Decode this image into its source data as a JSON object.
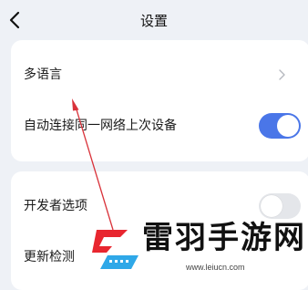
{
  "header": {
    "title": "设置",
    "back_icon": "chevron-left-icon"
  },
  "settings_group_1": {
    "rows": [
      {
        "label": "多语言",
        "control": "chevron-right-icon"
      },
      {
        "label": "自动连接同一网络上次设备",
        "control": "toggle",
        "state": "on"
      }
    ]
  },
  "settings_group_2": {
    "rows": [
      {
        "label": "开发者选项",
        "control": "toggle",
        "state": "off"
      },
      {
        "label": "更新检测"
      }
    ]
  },
  "watermark": {
    "brand": "雷羽手游网",
    "url": "www.leiucn.com"
  },
  "colors": {
    "background": "#eef1f6",
    "card": "#ffffff",
    "toggle_on": "#4a76e8",
    "toggle_off": "#e4e6ea",
    "annotation_arrow": "#d9323a",
    "logo_red": "#e8262f",
    "logo_blue": "#2fa8e8"
  }
}
